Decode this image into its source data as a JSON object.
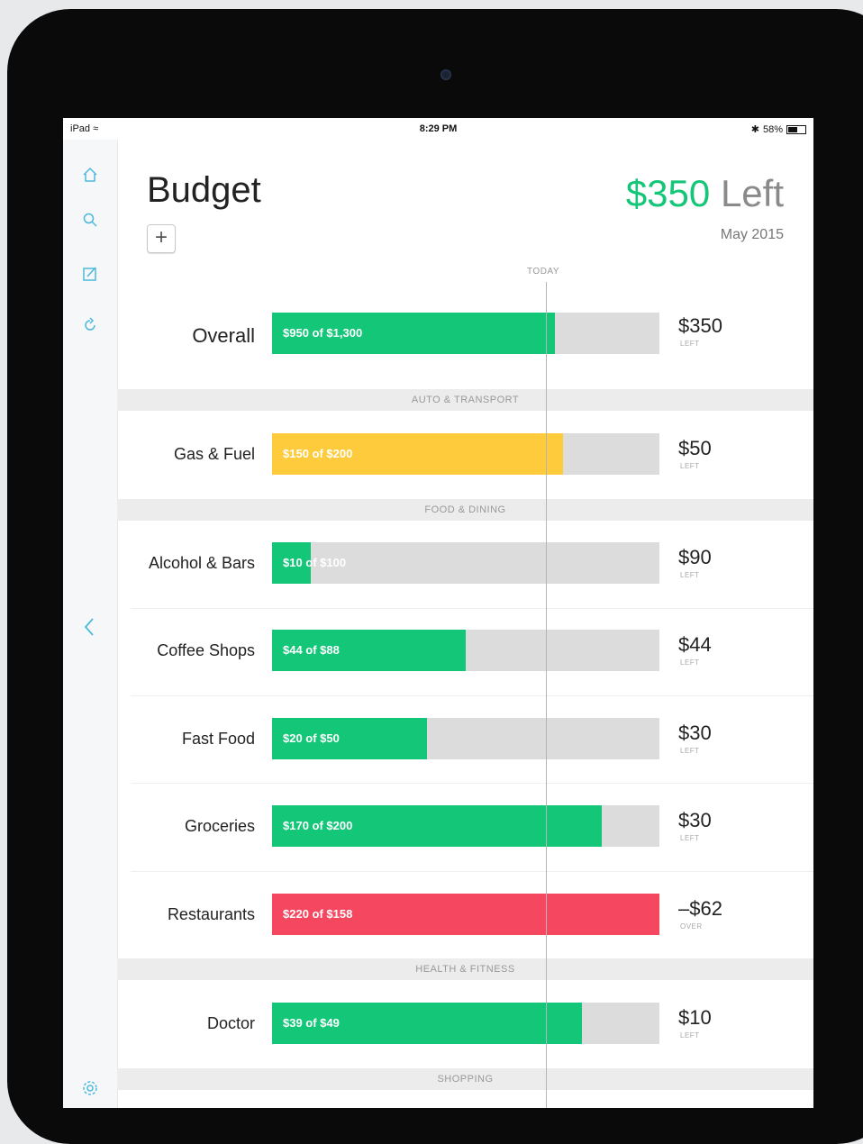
{
  "status_bar": {
    "device": "iPad",
    "time": "8:29 PM",
    "battery": "58%"
  },
  "sidebar": {
    "icons": [
      "home-icon",
      "search-icon",
      "compose-icon",
      "refresh-icon",
      "back-icon",
      "settings-icon"
    ]
  },
  "header": {
    "title": "Budget",
    "add_label": "+",
    "left_amount": "$350",
    "left_label": "Left",
    "month": "May 2015"
  },
  "timeline": {
    "today_label": "TODAY"
  },
  "colors": {
    "green": "#14c678",
    "yellow": "#fecb3c",
    "red": "#f54760",
    "track": "#dcdcdc",
    "accent": "#4cb8dc"
  },
  "overall": {
    "label": "Overall",
    "bar_text": "$950 of $1,300",
    "progress": 0.73,
    "amount": "$350",
    "status": "LEFT"
  },
  "sections": [
    {
      "title": "AUTO & TRANSPORT"
    },
    {
      "title": "FOOD & DINING"
    },
    {
      "title": "HEALTH & FITNESS"
    },
    {
      "title": "SHOPPING"
    }
  ],
  "budgets": [
    {
      "label": "Gas & Fuel",
      "bar_text": "$150 of $200",
      "progress": 0.75,
      "color": "#fecb3c",
      "amount": "$50",
      "status": "LEFT"
    },
    {
      "label": "Alcohol & Bars",
      "bar_text": "$10 of $100",
      "progress": 0.1,
      "color": "#14c678",
      "amount": "$90",
      "status": "LEFT"
    },
    {
      "label": "Coffee Shops",
      "bar_text": "$44 of $88",
      "progress": 0.5,
      "color": "#14c678",
      "amount": "$44",
      "status": "LEFT"
    },
    {
      "label": "Fast Food",
      "bar_text": "$20 of $50",
      "progress": 0.4,
      "color": "#14c678",
      "amount": "$30",
      "status": "LEFT"
    },
    {
      "label": "Groceries",
      "bar_text": "$170 of $200",
      "progress": 0.85,
      "color": "#14c678",
      "amount": "$30",
      "status": "LEFT"
    },
    {
      "label": "Restaurants",
      "bar_text": "$220 of $158",
      "progress": 1.0,
      "color": "#f54760",
      "amount": "–$62",
      "status": "OVER"
    },
    {
      "label": "Doctor",
      "bar_text": "$39 of $49",
      "progress": 0.8,
      "color": "#14c678",
      "amount": "$10",
      "status": "LEFT"
    }
  ]
}
